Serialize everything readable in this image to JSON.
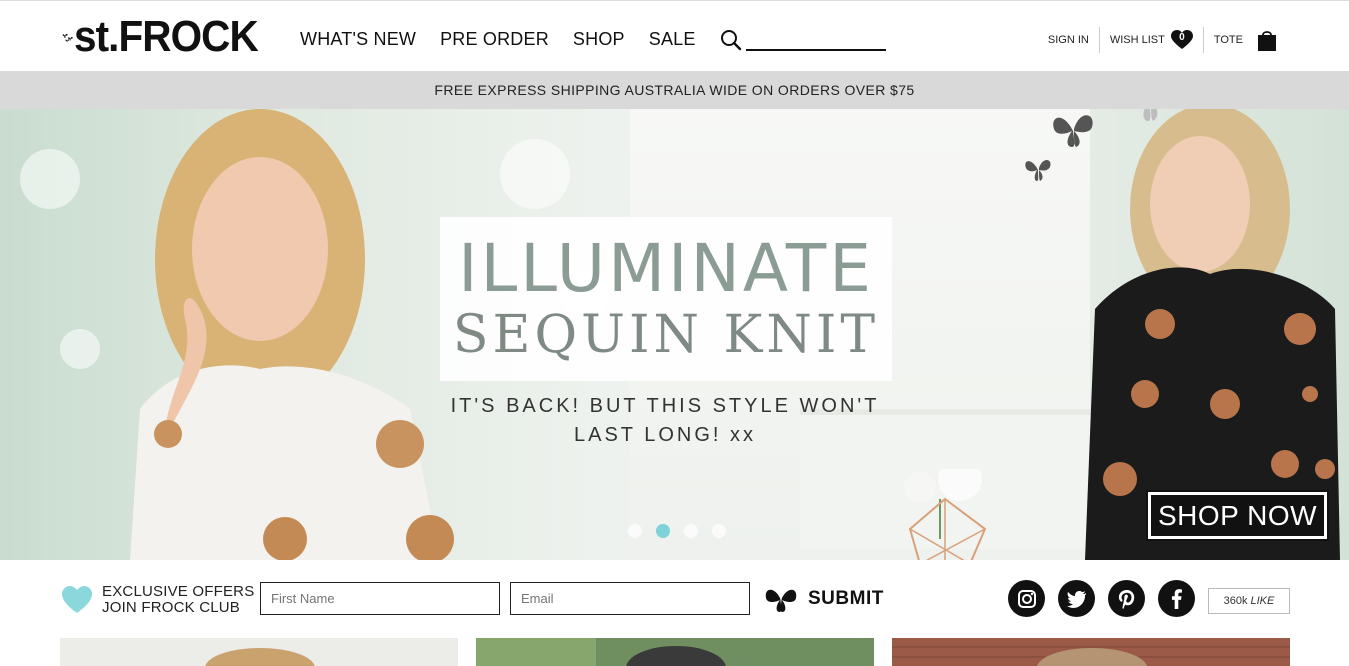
{
  "header": {
    "logo_text": "st.FROCK",
    "nav": [
      "WHAT'S NEW",
      "PRE ORDER",
      "SHOP",
      "SALE"
    ],
    "search_placeholder": "",
    "sign_in": "SIGN IN",
    "wish_list": "WISH LIST",
    "wish_count": "0",
    "tote": "TOTE"
  },
  "shipping_banner": "FREE EXPRESS SHIPPING AUSTRALIA WIDE ON ORDERS OVER $75",
  "hero": {
    "headline_1": "ILLUMINATE",
    "headline_2": "SEQUIN KNIT",
    "tagline_1": "IT'S BACK! BUT THIS STYLE WON'T",
    "tagline_2": "LAST LONG! xx",
    "cta": "SHOP NOW",
    "slides": 4,
    "active_slide": 2
  },
  "club": {
    "line_1": "EXCLUSIVE OFFERS",
    "line_2": "JOIN FROCK CLUB",
    "first_name_placeholder": "First Name",
    "email_placeholder": "Email",
    "submit": "SUBMIT"
  },
  "social": {
    "icons": [
      "instagram-icon",
      "twitter-icon",
      "pinterest-icon",
      "facebook-icon"
    ],
    "likes": "360k",
    "likes_suffix": "LIKE"
  },
  "colors": {
    "accent": "#7fd3d8",
    "ink": "#111111",
    "banner_bg": "#d9d9d9"
  }
}
